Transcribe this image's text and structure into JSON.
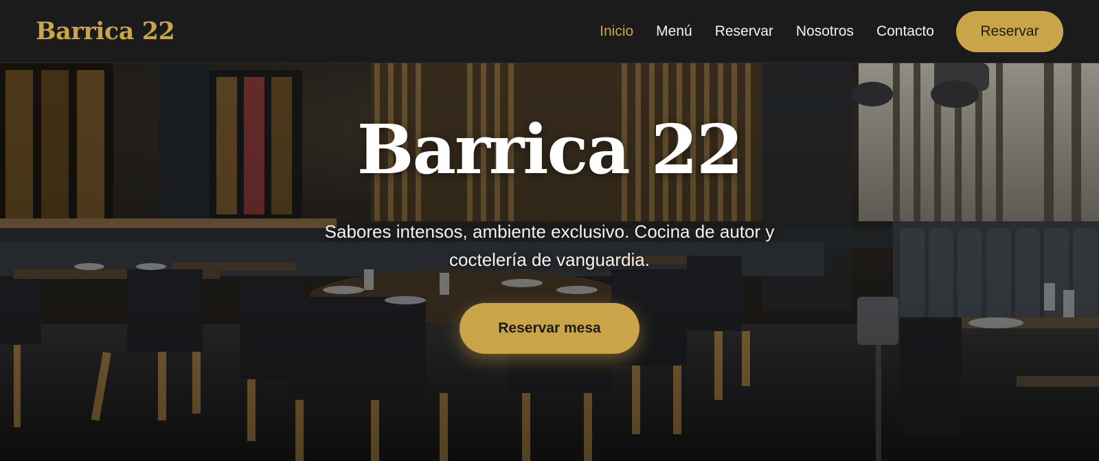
{
  "header": {
    "brand": "Barrica 22",
    "nav": [
      {
        "label": "Inicio",
        "active": true
      },
      {
        "label": "Menú",
        "active": false
      },
      {
        "label": "Reservar",
        "active": false
      },
      {
        "label": "Nosotros",
        "active": false
      },
      {
        "label": "Contacto",
        "active": false
      }
    ],
    "cta_label": "Reservar"
  },
  "hero": {
    "title": "Barrica 22",
    "subtitle": "Sabores intensos, ambiente exclusivo. Cocina de autor y coctelería de vanguardia.",
    "cta_label": "Reservar mesa",
    "background": "restaurant-interior-photo"
  },
  "colors": {
    "accent": "#c9a449",
    "nav_background": "#1b1b1b",
    "nav_text": "#f2f2f2",
    "hero_text": "#ffffff"
  }
}
